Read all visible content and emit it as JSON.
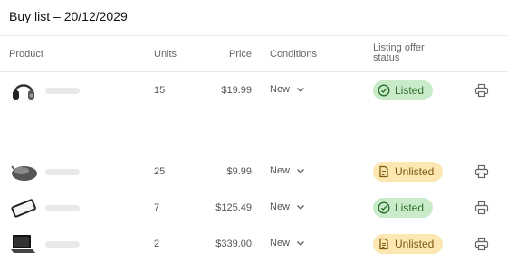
{
  "page": {
    "title": "Buy list – 20/12/2029"
  },
  "columns": {
    "product": "Product",
    "units": "Units",
    "price": "Price",
    "conditions": "Conditions",
    "status_line1": "Listing offer",
    "status_line2": "status"
  },
  "rows": [
    {
      "product_icon": "headphones-icon",
      "units": "15",
      "price": "$19.99",
      "condition": "New",
      "status": "Listed"
    },
    {
      "product_icon": "mouse-icon",
      "units": "25",
      "price": "$9.99",
      "condition": "New",
      "status": "Unlisted"
    },
    {
      "product_icon": "phone-icon",
      "units": "7",
      "price": "$125.49",
      "condition": "New",
      "status": "Listed"
    },
    {
      "product_icon": "laptop-icon",
      "units": "2",
      "price": "$339.00",
      "condition": "New",
      "status": "Unlisted"
    }
  ],
  "colors": {
    "listed_bg": "#c9ebc9",
    "listed_text": "#2e6f2e",
    "unlisted_bg": "#fce7b0",
    "unlisted_text": "#7a5a12"
  }
}
